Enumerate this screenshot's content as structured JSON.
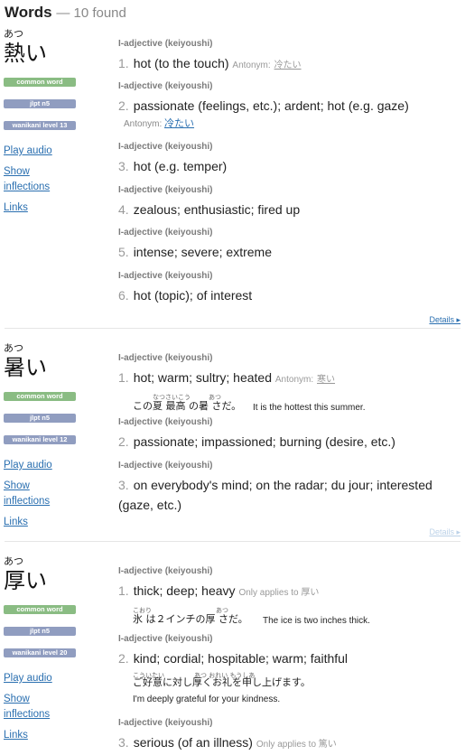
{
  "header": {
    "title": "Words",
    "count": "— 10 found"
  },
  "words": [
    {
      "reading": "あつ",
      "kanji": "熱い",
      "tags": [
        "common word",
        "jlpt n5",
        "wanikani level 13"
      ],
      "links": [
        "Play audio",
        "Show",
        "inflections",
        "Links"
      ],
      "senses": [
        {
          "pos": "I-adjective (keiyoushi)",
          "num": "1.",
          "text": "hot (to the touch)",
          "ann_label": "Antonym:",
          "ann_link": "冷たい"
        },
        {
          "pos": "I-adjective (keiyoushi)",
          "num": "2.",
          "text": "passionate (feelings, etc.); ardent; hot (e.g. gaze)",
          "ann_label": "Antonym:",
          "ann_link": "冷たい"
        },
        {
          "pos": "I-adjective (keiyoushi)",
          "num": "3.",
          "text": "hot (e.g. temper)"
        },
        {
          "pos": "I-adjective (keiyoushi)",
          "num": "4.",
          "text": "zealous; enthusiastic; fired up"
        },
        {
          "pos": "I-adjective (keiyoushi)",
          "num": "5.",
          "text": "intense; severe; extreme"
        },
        {
          "pos": "I-adjective (keiyoushi)",
          "num": "6.",
          "text": "hot (topic); of interest"
        }
      ],
      "details": "Details ▸"
    },
    {
      "reading": "あつ",
      "kanji": "暑い",
      "tags": [
        "common word",
        "jlpt n5",
        "wanikani level 12"
      ],
      "links": [
        "Play audio",
        "Show",
        "inflections",
        "Links"
      ],
      "senses": [
        {
          "pos": "I-adjective (keiyoushi)",
          "num": "1.",
          "text": "hot; warm; sultry; heated",
          "ann_label": "Antonym:",
          "ann_link": "寒い",
          "example": {
            "jp": "この夏 最高 の暑 さだ。",
            "rt1": "なつさいこう",
            "rt2": "あつ",
            "en": "It is the hottest this summer."
          }
        },
        {
          "pos": "I-adjective (keiyoushi)",
          "num": "2.",
          "text": "passionate; impassioned; burning (desire, etc.)"
        },
        {
          "pos": "I-adjective (keiyoushi)",
          "num": "3.",
          "text": "on everybody's mind; on the radar; du jour; interested",
          "text2": "(gaze, etc.)"
        }
      ],
      "details": "Details ▸"
    },
    {
      "reading": "あつ",
      "kanji": "厚い",
      "tags": [
        "common word",
        "jlpt n5",
        "wanikani level 20"
      ],
      "links": [
        "Play audio",
        "Show",
        "inflections",
        "Links"
      ],
      "senses": [
        {
          "pos": "I-adjective (keiyoushi)",
          "num": "1.",
          "text": "thick; deep; heavy",
          "ann_label": "Only applies to 厚い",
          "example": {
            "jp": "氷 は２インチの厚 さだ。",
            "rt1": "こおり",
            "rt2": "あつ",
            "en": "The ice is two inches thick."
          }
        },
        {
          "pos": "I-adjective (keiyoushi)",
          "num": "2.",
          "text": "kind; cordial; hospitable; warm; faithful",
          "example": {
            "jp": "ご好意に対し厚くお礼を申し上げます。",
            "rt1": "こういたい",
            "rt2": "あつ おれい もうしあ",
            "en": "I'm deeply grateful for your kindness."
          }
        },
        {
          "pos": "I-adjective (keiyoushi)",
          "num": "3.",
          "text": "serious (of an illness)",
          "ann_label": "Only applies to 篤い"
        }
      ]
    }
  ]
}
